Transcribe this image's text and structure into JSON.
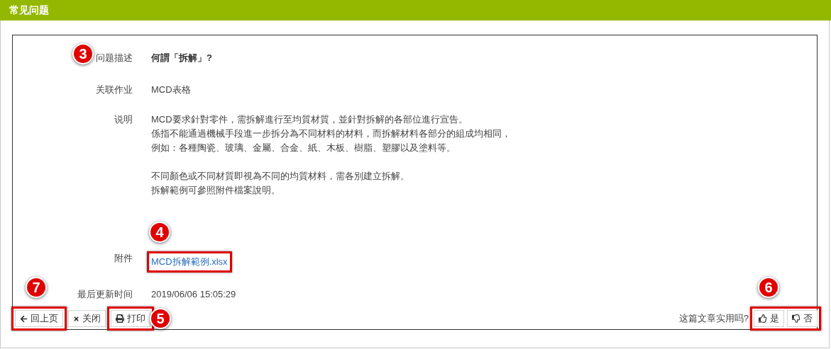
{
  "header": {
    "title": "常见问题"
  },
  "rows": [
    {
      "kind": "question",
      "label": "问题描述",
      "value": "何謂「拆解」?",
      "callout": "3"
    },
    {
      "kind": "text",
      "label": "关联作业",
      "value": "MCD表格"
    },
    {
      "kind": "paragraphs",
      "label": "说明",
      "paragraphs": [
        [
          "MCD要求針對零件，需拆解進行至均質材質，並針對拆解的各部位進行宣告。",
          "係指不能通過機械手段進一步拆分為不同材料的材料，而拆解材料各部分的組成均相同，",
          "例如：各種陶瓷、玻璃、金屬、合金、紙、木板、樹脂、塑膠以及塗料等。"
        ],
        [
          "不同顏色或不同材質即視為不同的均質材料，需各別建立拆解。",
          "拆解範例可參照附件檔案說明。"
        ]
      ]
    },
    {
      "kind": "link",
      "label": "附件",
      "value": "MCD拆解範例.xlsx",
      "callout": "4",
      "highlighted": true
    },
    {
      "kind": "text",
      "label": "最后更新时间",
      "value": "2019/06/06 15:05:29"
    }
  ],
  "footer": {
    "buttons": [
      {
        "kind": "back",
        "label": "回上页",
        "highlighted": true,
        "callout": "7"
      },
      {
        "kind": "close",
        "label": "关闭",
        "highlighted": false
      },
      {
        "kind": "print",
        "label": "打印",
        "highlighted": true,
        "callout": "5"
      }
    ],
    "feedback": {
      "question": "这篇文章实用吗?",
      "highlighted": true,
      "callout": "6",
      "buttons": [
        {
          "kind": "up",
          "label": "是"
        },
        {
          "kind": "down",
          "label": "否"
        }
      ]
    }
  }
}
